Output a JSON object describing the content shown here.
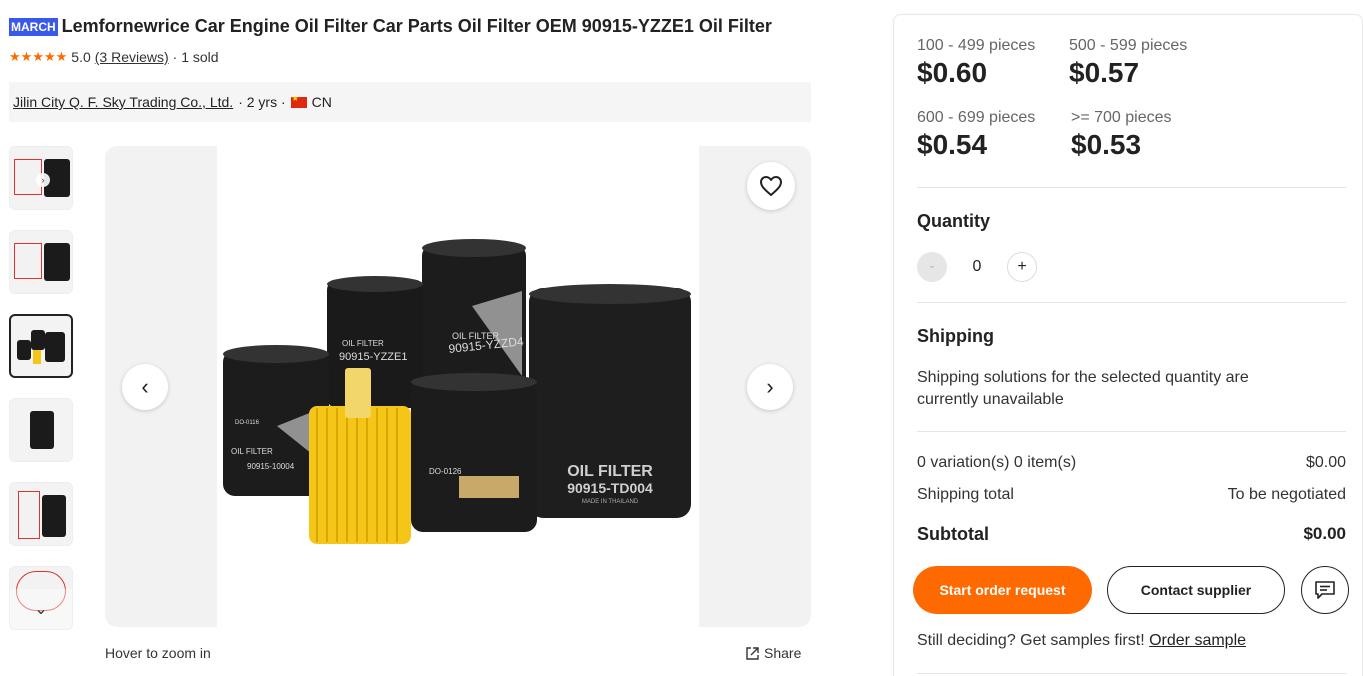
{
  "product": {
    "badge": "MARCH",
    "title": "Lemfornewrice Car Engine Oil Filter Car Parts Oil Filter OEM 90915-YZZE1 Oil Filter",
    "rating": "5.0",
    "reviews_link": "(3 Reviews)",
    "sold": "· 1 sold",
    "stars": "★★★★★"
  },
  "supplier": {
    "name": "Jilin City Q. F. Sky Trading Co., Ltd.",
    "years": "· 2 yrs ·",
    "country": "CN"
  },
  "gallery": {
    "hover_hint": "Hover to zoom in",
    "share_label": "Share",
    "prev_glyph": "‹",
    "next_glyph": "›",
    "filters": [
      {
        "label_top": "OIL FILTER",
        "label_bottom": "90915-YZZE1"
      },
      {
        "label_top": "OIL FILTER",
        "label_bottom": "90915-YZZD4"
      },
      {
        "label_top": "OIL FILTER",
        "label_bottom": "90915-10004"
      },
      {
        "label_top": "OIL FILTER",
        "label_bottom": "90915-TD004"
      },
      {
        "label_top": "DO-0116",
        "label_bottom": ""
      },
      {
        "label_top": "DO-0126",
        "label_bottom": ""
      },
      {
        "label_top": "MADE IN THAILAND",
        "label_bottom": ""
      }
    ]
  },
  "pricing": {
    "tiers": [
      {
        "range": "100 - 499 pieces",
        "price": "$0.60"
      },
      {
        "range": "500 - 599 pieces",
        "price": "$0.57"
      },
      {
        "range": "600 - 699 pieces",
        "price": "$0.54"
      },
      {
        "range": ">= 700 pieces",
        "price": "$0.53"
      }
    ]
  },
  "quantity": {
    "title": "Quantity",
    "value": "0",
    "minus": "-",
    "plus": "+"
  },
  "shipping": {
    "title": "Shipping",
    "message": "Shipping solutions for the selected quantity are currently unavailable"
  },
  "summary": {
    "variations_label": "0 variation(s) 0 item(s)",
    "variations_value": "$0.00",
    "shipping_label": "Shipping total",
    "shipping_value": "To be negotiated",
    "subtotal_label": "Subtotal",
    "subtotal_value": "$0.00"
  },
  "actions": {
    "order_label": "Start order request",
    "contact_label": "Contact supplier",
    "samples_prefix": "Still deciding? Get samples first!",
    "samples_link": "Order sample"
  },
  "colors": {
    "accent": "#ff6a00",
    "badge": "#3b59e8",
    "filter_yellow": "#f5c518"
  }
}
